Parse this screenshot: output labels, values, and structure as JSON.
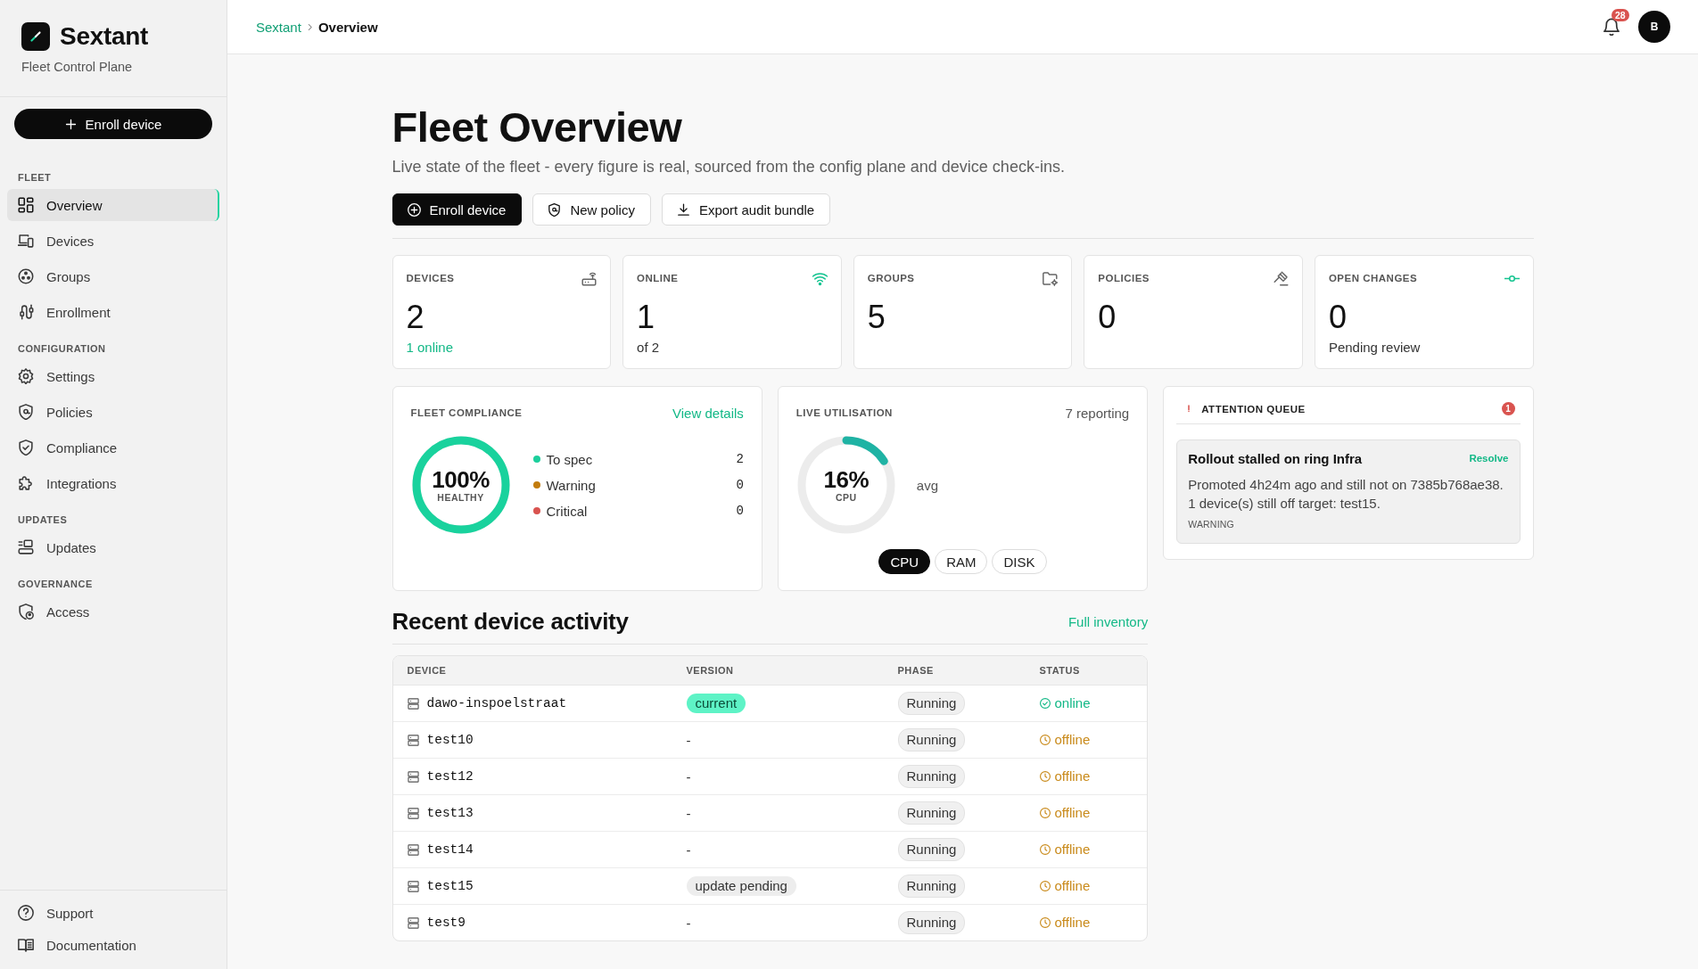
{
  "sidebar": {
    "brand": {
      "name": "Sextant",
      "tagline": "Fleet Control Plane"
    },
    "primary_action": "Enroll device",
    "sections": [
      {
        "heading": "FLEET",
        "items": [
          {
            "label": "Overview",
            "selected": true
          },
          {
            "label": "Devices",
            "selected": false
          },
          {
            "label": "Groups",
            "selected": false
          },
          {
            "label": "Enrollment",
            "selected": false
          }
        ]
      },
      {
        "heading": "CONFIGURATION",
        "items": [
          {
            "label": "Settings",
            "selected": false
          },
          {
            "label": "Policies",
            "selected": false
          },
          {
            "label": "Compliance",
            "selected": false
          },
          {
            "label": "Integrations",
            "selected": false
          }
        ]
      },
      {
        "heading": "UPDATES",
        "items": [
          {
            "label": "Updates",
            "selected": false
          }
        ]
      },
      {
        "heading": "GOVERNANCE",
        "items": [
          {
            "label": "Access",
            "selected": false
          }
        ]
      }
    ],
    "footer_links": [
      "Support",
      "Documentation"
    ]
  },
  "header": {
    "breadcrumb": [
      {
        "label": "Sextant",
        "current": false
      },
      {
        "label": "Overview",
        "current": true
      }
    ],
    "notification_count": "28",
    "avatar_initial": "B"
  },
  "page": {
    "title": "Fleet Overview",
    "subtitle": "Live state of the fleet - every figure is real, sourced from the config plane and device check-ins.",
    "actions": [
      {
        "label": "Enroll device",
        "kind": "primary"
      },
      {
        "label": "New policy",
        "kind": "secondary"
      },
      {
        "label": "Export audit bundle",
        "kind": "secondary"
      }
    ]
  },
  "stats": [
    {
      "label": "DEVICES",
      "value": "2",
      "note": "1 online",
      "note_accent": true,
      "icon_accent": false
    },
    {
      "label": "ONLINE",
      "value": "1",
      "note": "of 2",
      "note_accent": false,
      "icon_accent": true
    },
    {
      "label": "GROUPS",
      "value": "5",
      "icon_accent": false
    },
    {
      "label": "POLICIES",
      "value": "0",
      "icon_accent": false
    },
    {
      "label": "OPEN CHANGES",
      "value": "0",
      "note": "Pending review",
      "note_accent": false,
      "icon_accent": true
    }
  ],
  "compliance": {
    "title": "FLEET COMPLIANCE",
    "link": "View details",
    "gauge": {
      "value": "100%",
      "caption": "HEALTHY",
      "level": 1
    },
    "legend": [
      {
        "label": "To spec",
        "count": "2",
        "color": "#1ccf9c"
      },
      {
        "label": "Warning",
        "count": "0",
        "color": "#c27c0e"
      },
      {
        "label": "Critical",
        "count": "0",
        "color": "#d9534f"
      }
    ]
  },
  "utilisation": {
    "title": "LIVE UTILISATION",
    "meta": "7 reporting",
    "gauge": {
      "value": "16%",
      "caption": "CPU",
      "level": 0.16
    },
    "aside": "avg",
    "tabs": [
      {
        "label": "CPU",
        "selected": true
      },
      {
        "label": "RAM",
        "selected": false
      },
      {
        "label": "DISK",
        "selected": false
      }
    ]
  },
  "attention_queue": {
    "title": "ATTENTION QUEUE",
    "count": "1",
    "items": [
      {
        "title": "Rollout stalled on ring Infra",
        "action": "Resolve",
        "body_lines": [
          "Promoted 4h24m ago and still not on 7385b768ae38.",
          "1 device(s) still off target: test15."
        ],
        "severity": "WARNING"
      }
    ]
  },
  "recent_activity": {
    "title": "Recent device activity",
    "link": "Full inventory",
    "table": {
      "columns": [
        "DEVICE",
        "VERSION",
        "PHASE",
        "STATUS"
      ],
      "rows": [
        {
          "device": "dawo-inspoelstraat",
          "version": {
            "text": "current",
            "kind": "accent"
          },
          "phase": "Running",
          "status": "online",
          "online": true
        },
        {
          "device": "test10",
          "version": {
            "text": "-",
            "kind": "plain"
          },
          "phase": "Running",
          "status": "offline",
          "online": false
        },
        {
          "device": "test12",
          "version": {
            "text": "-",
            "kind": "plain"
          },
          "phase": "Running",
          "status": "offline",
          "online": false
        },
        {
          "device": "test13",
          "version": {
            "text": "-",
            "kind": "plain"
          },
          "phase": "Running",
          "status": "offline",
          "online": false
        },
        {
          "device": "test14",
          "version": {
            "text": "-",
            "kind": "plain"
          },
          "phase": "Running",
          "status": "offline",
          "online": false
        },
        {
          "device": "test15",
          "version": {
            "text": "update pending",
            "kind": "muted"
          },
          "phase": "Running",
          "status": "offline",
          "online": false
        },
        {
          "device": "test9",
          "version": {
            "text": "-",
            "kind": "plain"
          },
          "phase": "Running",
          "status": "offline",
          "online": false
        }
      ]
    }
  }
}
